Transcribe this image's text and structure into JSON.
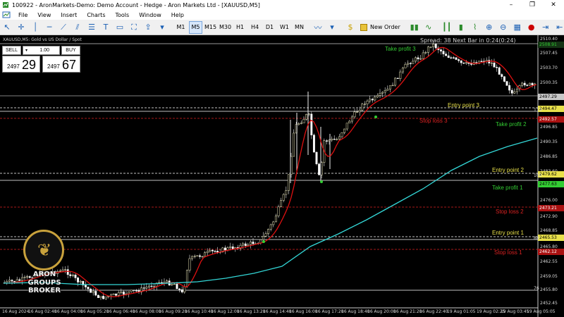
{
  "window": {
    "title": "100922 - AronMarkets-Demo: Demo Account - Hedge - Aron Markets Ltd - [XAUUSD,M5]",
    "minimize": "–",
    "restore": "❐",
    "close": "✕"
  },
  "menu": [
    "File",
    "View",
    "Insert",
    "Charts",
    "Tools",
    "Window",
    "Help"
  ],
  "toolbar": {
    "timeframes": [
      "M1",
      "M5",
      "M15",
      "M30",
      "H1",
      "H4",
      "D1",
      "W1",
      "MN"
    ],
    "active_timeframe": "M5",
    "new_order": "New Order"
  },
  "chart": {
    "symbol_title": "XAUUSD,M5:  Gold vs US Dollar / Spot",
    "spread_text": "Spread: 38  Next Bar in 0:24(0:24)",
    "one_click": {
      "sell_label": "SELL",
      "buy_label": "BUY",
      "lot": "1.00",
      "sell_pre": "2497",
      "sell_big": "29",
      "buy_pre": "2497",
      "buy_big": "67"
    },
    "labels": [
      {
        "key": "tp3",
        "text": "Take profit 3",
        "color": "#33cc33"
      },
      {
        "key": "ep3",
        "text": "Entry point 3",
        "color": "#e8e04a"
      },
      {
        "key": "sl3",
        "text": "Stop loss 3",
        "color": "#dd2222"
      },
      {
        "key": "tp2",
        "text": "Take profit 2",
        "color": "#33cc33"
      },
      {
        "key": "ep2",
        "text": "Entry point 2",
        "color": "#e8e04a"
      },
      {
        "key": "tp1",
        "text": "Take profit 1",
        "color": "#33cc33"
      },
      {
        "key": "sl2",
        "text": "Stop loss 2",
        "color": "#dd2222"
      },
      {
        "key": "ep1",
        "text": "Entry point 1",
        "color": "#e8e04a"
      },
      {
        "key": "sl1",
        "text": "Stop loss 1",
        "color": "#dd2222"
      }
    ],
    "price_tags": [
      {
        "text": "2508.91",
        "color": "#33cc33",
        "bg": "#143314"
      },
      {
        "text": "2497.29",
        "color": "#000000",
        "bg": "#c8c8c8"
      },
      {
        "text": "2494.47",
        "color": "#000000",
        "bg": "#e8e04a"
      },
      {
        "text": "2492.57",
        "color": "#ffffff",
        "bg": "#aa1111"
      },
      {
        "text": "2479.62",
        "color": "#000000",
        "bg": "#e8e04a"
      },
      {
        "text": "2477.63",
        "color": "#000000",
        "bg": "#33cc33"
      },
      {
        "text": "2473.21",
        "color": "#ffffff",
        "bg": "#aa1111"
      },
      {
        "text": "2465.53",
        "color": "#000000",
        "bg": "#e8e04a"
      },
      {
        "text": "2462.12",
        "color": "#ffffff",
        "bg": "#aa1111"
      }
    ],
    "side_values": [
      "113",
      "100",
      "88",
      "76"
    ],
    "y_ticks": [
      "2510.40",
      "2507.45",
      "2503.70",
      "2500.35",
      "2496.85",
      "2490.35",
      "2486.85",
      "2483.60",
      "2479.50",
      "2476.00",
      "2472.90",
      "2468.85",
      "2465.80",
      "2462.55",
      "2459.05",
      "2455.80",
      "2452.45"
    ],
    "x_ticks": [
      "16 Aug 2024",
      "16 Aug 02:40",
      "16 Aug 04:00",
      "16 Aug 05:20",
      "16 Aug 06:40",
      "16 Aug 08:00",
      "16 Aug 09:20",
      "16 Aug 10:40",
      "16 Aug 12:00",
      "16 Aug 13:20",
      "16 Aug 14:40",
      "16 Aug 16:00",
      "16 Aug 17:20",
      "16 Aug 18:40",
      "16 Aug 20:00",
      "16 Aug 21:20",
      "16 Aug 22:40",
      "19 Aug 01:05",
      "19 Aug 02:25",
      "19 Aug 03:45",
      "19 Aug 05:05"
    ]
  },
  "logo": {
    "line1": "ARON",
    "line2": "GROUPS",
    "line3": "BROKER"
  },
  "colors": {
    "bull": "#f5f0c0",
    "bear": "#ffffff",
    "ma_fast": "#dd1111",
    "ma_slow": "#33d6d6",
    "grid": "#cccccc"
  }
}
